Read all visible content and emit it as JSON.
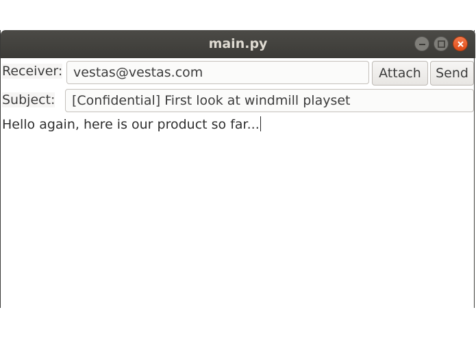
{
  "window": {
    "title": "main.py"
  },
  "form": {
    "receiver_label": "Receiver:",
    "receiver_value": "vestas@vestas.com",
    "subject_label": "Subject:",
    "subject_value": "[Confidential] First look at windmill playset",
    "attach_label": "Attach",
    "send_label": "Send",
    "body_text": "Hello again, here is our product so far..."
  },
  "icons": {
    "minimize": "minimize-icon",
    "maximize": "maximize-icon",
    "close": "close-icon"
  },
  "colors": {
    "titlebar": "#3c3b37",
    "close_button": "#e95420"
  }
}
